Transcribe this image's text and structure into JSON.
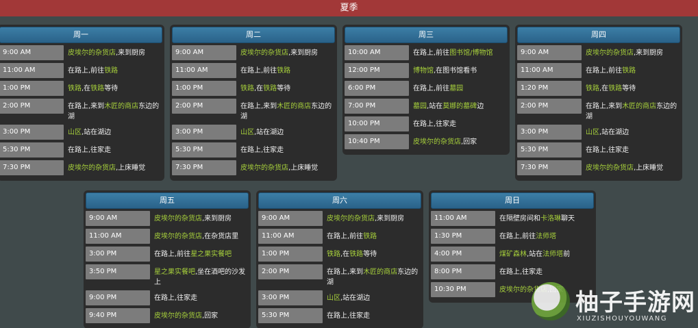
{
  "season": "夏季",
  "days": [
    {
      "label": "周一",
      "entries": [
        {
          "time": "9:00 AM",
          "parts": [
            {
              "t": "皮埃尔的杂货店",
              "hl": true
            },
            {
              "t": ",来到厨房"
            }
          ]
        },
        {
          "time": "11:00 AM",
          "parts": [
            {
              "t": "在路上,前往"
            },
            {
              "t": "铁路",
              "hl": true
            }
          ]
        },
        {
          "time": "1:00 PM",
          "parts": [
            {
              "t": "铁路",
              "hl": true
            },
            {
              "t": ",在"
            },
            {
              "t": "铁路",
              "hl": true
            },
            {
              "t": "等待"
            }
          ]
        },
        {
          "time": "2:00 PM",
          "parts": [
            {
              "t": "在路上,来到"
            },
            {
              "t": "木匠的商店",
              "hl": true
            },
            {
              "t": "东边的湖"
            }
          ]
        },
        {
          "time": "3:00 PM",
          "parts": [
            {
              "t": "山区",
              "hl": true
            },
            {
              "t": ",站在湖边"
            }
          ]
        },
        {
          "time": "5:30 PM",
          "parts": [
            {
              "t": "在路上,往家走"
            }
          ]
        },
        {
          "time": "7:30 PM",
          "parts": [
            {
              "t": "皮埃尔的杂货店",
              "hl": true
            },
            {
              "t": ",上床睡觉"
            }
          ]
        }
      ]
    },
    {
      "label": "周二",
      "entries": [
        {
          "time": "9:00 AM",
          "parts": [
            {
              "t": "皮埃尔的杂货店",
              "hl": true
            },
            {
              "t": ",来到厨房"
            }
          ]
        },
        {
          "time": "11:00 AM",
          "parts": [
            {
              "t": "在路上,前往"
            },
            {
              "t": "铁路",
              "hl": true
            }
          ]
        },
        {
          "time": "1:00 PM",
          "parts": [
            {
              "t": "铁路",
              "hl": true
            },
            {
              "t": ",在"
            },
            {
              "t": "铁路",
              "hl": true
            },
            {
              "t": "等待"
            }
          ]
        },
        {
          "time": "2:00 PM",
          "parts": [
            {
              "t": "在路上,来到"
            },
            {
              "t": "木匠的商店",
              "hl": true
            },
            {
              "t": "东边的湖"
            }
          ]
        },
        {
          "time": "3:00 PM",
          "parts": [
            {
              "t": "山区",
              "hl": true
            },
            {
              "t": ",站在湖边"
            }
          ]
        },
        {
          "time": "5:30 PM",
          "parts": [
            {
              "t": "在路上,往家走"
            }
          ]
        },
        {
          "time": "7:30 PM",
          "parts": [
            {
              "t": "皮埃尔的杂货店",
              "hl": true
            },
            {
              "t": ",上床睡觉"
            }
          ]
        }
      ]
    },
    {
      "label": "周三",
      "entries": [
        {
          "time": "10:00 AM",
          "parts": [
            {
              "t": "在路上,前往"
            },
            {
              "t": "图书馆/博物馆",
              "hl": true
            }
          ]
        },
        {
          "time": "12:00 PM",
          "parts": [
            {
              "t": "博物馆",
              "hl": true
            },
            {
              "t": ",在图书馆看书"
            }
          ]
        },
        {
          "time": "6:00 PM",
          "parts": [
            {
              "t": "在路上,前往"
            },
            {
              "t": "墓园",
              "hl": true
            }
          ]
        },
        {
          "time": "7:00 PM",
          "parts": [
            {
              "t": "墓园",
              "hl": true
            },
            {
              "t": ",站在"
            },
            {
              "t": "莫娜的墓碑",
              "hl": true
            },
            {
              "t": "边"
            }
          ]
        },
        {
          "time": "10:00 PM",
          "parts": [
            {
              "t": "在路上,往家走"
            }
          ]
        },
        {
          "time": "10:40 PM",
          "parts": [
            {
              "t": "皮埃尔的杂货店",
              "hl": true
            },
            {
              "t": ",回家"
            }
          ]
        }
      ]
    },
    {
      "label": "周四",
      "entries": [
        {
          "time": "9:00 AM",
          "parts": [
            {
              "t": "皮埃尔的杂货店",
              "hl": true
            },
            {
              "t": ",来到厨房"
            }
          ]
        },
        {
          "time": "11:00 AM",
          "parts": [
            {
              "t": "在路上,前往"
            },
            {
              "t": "铁路",
              "hl": true
            }
          ]
        },
        {
          "time": "1:20 PM",
          "parts": [
            {
              "t": "铁路",
              "hl": true
            },
            {
              "t": ",在"
            },
            {
              "t": "铁路",
              "hl": true
            },
            {
              "t": "等待"
            }
          ]
        },
        {
          "time": "2:00 PM",
          "parts": [
            {
              "t": "在路上,来到"
            },
            {
              "t": "木匠的商店",
              "hl": true
            },
            {
              "t": "东边的湖"
            }
          ]
        },
        {
          "time": "3:00 PM",
          "parts": [
            {
              "t": "山区",
              "hl": true
            },
            {
              "t": ",站在湖边"
            }
          ]
        },
        {
          "time": "5:30 PM",
          "parts": [
            {
              "t": "在路上,往家走"
            }
          ]
        },
        {
          "time": "7:30 PM",
          "parts": [
            {
              "t": "皮埃尔的杂货店",
              "hl": true
            },
            {
              "t": ",上床睡觉"
            }
          ]
        }
      ]
    },
    {
      "label": "周五",
      "entries": [
        {
          "time": "9:00 AM",
          "parts": [
            {
              "t": "皮埃尔的杂货店",
              "hl": true
            },
            {
              "t": ",来到厨房"
            }
          ]
        },
        {
          "time": "11:00 AM",
          "parts": [
            {
              "t": "皮埃尔的杂货店",
              "hl": true
            },
            {
              "t": ",在杂货店里"
            }
          ]
        },
        {
          "time": "3:00 PM",
          "parts": [
            {
              "t": "在路上,前往"
            },
            {
              "t": "星之果实餐吧",
              "hl": true
            }
          ]
        },
        {
          "time": "3:50 PM",
          "parts": [
            {
              "t": "星之果实餐吧",
              "hl": true
            },
            {
              "t": ",坐在酒吧的沙发上"
            }
          ]
        },
        {
          "time": "9:00 PM",
          "parts": [
            {
              "t": "在路上,往家走"
            }
          ]
        },
        {
          "time": "9:40 PM",
          "parts": [
            {
              "t": "皮埃尔的杂货店",
              "hl": true
            },
            {
              "t": ",回家"
            }
          ]
        }
      ]
    },
    {
      "label": "周六",
      "entries": [
        {
          "time": "9:00 AM",
          "parts": [
            {
              "t": "皮埃尔的杂货店",
              "hl": true
            },
            {
              "t": ",来到厨房"
            }
          ]
        },
        {
          "time": "11:00 AM",
          "parts": [
            {
              "t": "在路上,前往"
            },
            {
              "t": "铁路",
              "hl": true
            }
          ]
        },
        {
          "time": "1:00 PM",
          "parts": [
            {
              "t": "铁路",
              "hl": true
            },
            {
              "t": ",在"
            },
            {
              "t": "铁路",
              "hl": true
            },
            {
              "t": "等待"
            }
          ]
        },
        {
          "time": "2:00 PM",
          "parts": [
            {
              "t": "在路上,来到"
            },
            {
              "t": "木匠的商店",
              "hl": true
            },
            {
              "t": "东边的湖"
            }
          ]
        },
        {
          "time": "3:00 PM",
          "parts": [
            {
              "t": "山区",
              "hl": true
            },
            {
              "t": ",站在湖边"
            }
          ]
        },
        {
          "time": "5:30 PM",
          "parts": [
            {
              "t": "在路上,往家走"
            }
          ]
        }
      ]
    },
    {
      "label": "周日",
      "entries": [
        {
          "time": "11:00 AM",
          "parts": [
            {
              "t": "在隔壁房间和"
            },
            {
              "t": "卡洛琳",
              "hl": true
            },
            {
              "t": "聊天"
            }
          ]
        },
        {
          "time": "1:30 PM",
          "parts": [
            {
              "t": "在路上,前往"
            },
            {
              "t": "法师塔",
              "hl": true
            }
          ]
        },
        {
          "time": "4:00 PM",
          "parts": [
            {
              "t": "煤矿森林",
              "hl": true
            },
            {
              "t": ",站在"
            },
            {
              "t": "法师塔",
              "hl": true
            },
            {
              "t": "前"
            }
          ]
        },
        {
          "time": "8:00 PM",
          "parts": [
            {
              "t": "在路上,往家走"
            }
          ]
        },
        {
          "time": "10:30 PM",
          "parts": [
            {
              "t": "皮埃尔的杂货店",
              "hl": true
            },
            {
              "t": ",回家"
            }
          ]
        }
      ]
    }
  ],
  "watermark": {
    "title": "柚子手游网",
    "subtitle": "XIUZISHOUYOUWANG"
  }
}
